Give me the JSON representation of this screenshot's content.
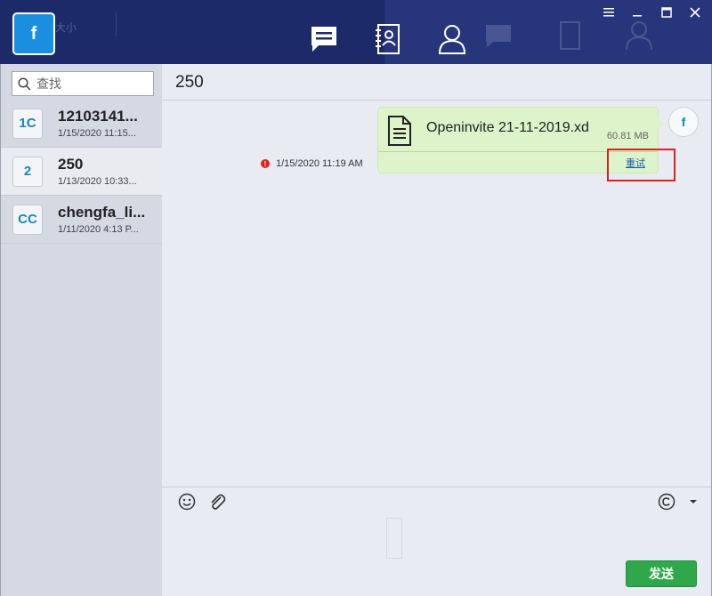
{
  "header": {
    "logo_letter": "f",
    "ghost_label": "大小",
    "nav": [
      "chat-icon",
      "contacts-icon",
      "profile-icon"
    ],
    "window_controls": [
      "menu-icon",
      "restore-icon",
      "maximize-icon",
      "close-icon"
    ]
  },
  "sidebar": {
    "search_placeholder": "查找",
    "contacts": [
      {
        "initials": "1C",
        "name": "12103141...",
        "time": "1/15/2020 11:15...",
        "selected": false
      },
      {
        "initials": "2",
        "name": "250",
        "time": "1/13/2020 10:33...",
        "selected": true
      },
      {
        "initials": "CC",
        "name": "chengfa_li...",
        "time": "1/11/2020 4:13 P...",
        "selected": false
      }
    ]
  },
  "chat": {
    "title": "250",
    "message": {
      "file_name": "Openinvite 21-11-2019.xd",
      "file_size": "60.81 MB",
      "retry_label": "重试",
      "timestamp": "1/15/2020 11:19 AM",
      "status": "failed",
      "avatar_letter": "f"
    }
  },
  "composer": {
    "tools": [
      "emoji-icon",
      "attachment-icon",
      "copyright-icon",
      "dropdown-arrow-icon"
    ],
    "send_label": "发送"
  },
  "colors": {
    "header_bg": "#1c2a6a",
    "accent_blue": "#1a8fe0",
    "bubble_bg": "#ddf3c9",
    "send_green": "#2ea84a",
    "error_red": "#e02020"
  }
}
